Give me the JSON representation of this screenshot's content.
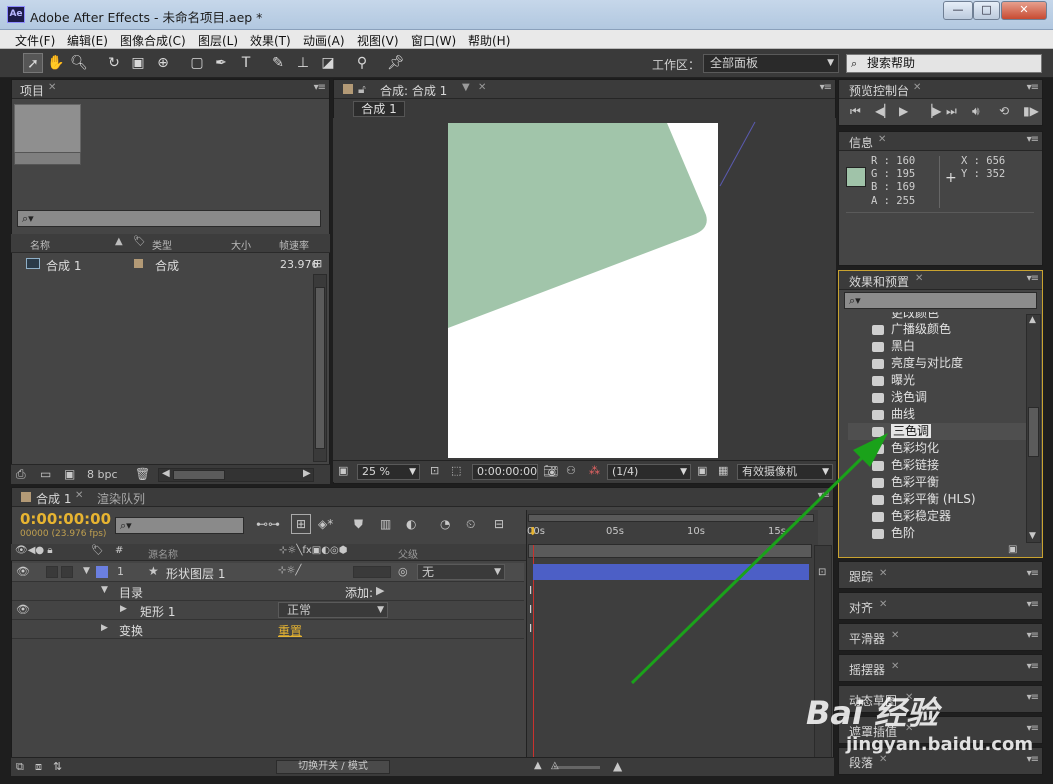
{
  "window": {
    "title": "Adobe After Effects - 未命名项目.aep *",
    "logo": "Ae",
    "buttons": [
      "—",
      "□",
      "✕"
    ]
  },
  "menu": [
    "文件(F)",
    "编辑(E)",
    "图像合成(C)",
    "图层(L)",
    "效果(T)",
    "动画(A)",
    "视图(V)",
    "窗口(W)",
    "帮助(H)"
  ],
  "toolbar": {
    "workspace_label": "工作区：",
    "workspace_value": "全部面板",
    "help_search": "搜索帮助"
  },
  "project": {
    "tab": "项目",
    "columns": [
      "名称",
      "类型",
      "大小",
      "帧速率"
    ],
    "rows": [
      {
        "name": "合成 1",
        "type": "合成",
        "fps": "23.976"
      }
    ],
    "bpc": "8 bpc"
  },
  "composition": {
    "tab": "合成: 合成 1",
    "subtab": "合成 1",
    "zoom": "25 %",
    "timecode": "0:00:00:00",
    "resolution": "(1/4)",
    "camera": "有效摄像机",
    "shape_color": "#a1c5aa"
  },
  "preview": {
    "tab": "预览控制台"
  },
  "info": {
    "tab": "信息",
    "r": "R : 160",
    "g": "G : 195",
    "b": "B : 169",
    "a": "A : 255",
    "x": "X : 656",
    "y": "Y : 352",
    "swatch": "#a0c3a9"
  },
  "effects": {
    "tab": "效果和预置",
    "items": [
      "更改颜色",
      "广播级颜色",
      "黑白",
      "亮度与对比度",
      "曝光",
      "浅色调",
      "曲线",
      "三色调",
      "色彩均化",
      "色彩链接",
      "色彩平衡",
      "色彩平衡 (HLS)",
      "色彩稳定器",
      "色阶"
    ],
    "highlighted": "三色调"
  },
  "side_panels": [
    "跟踪",
    "对齐",
    "平滑器",
    "摇摆器",
    "动态草图",
    "遮罩插值",
    "段落"
  ],
  "timeline": {
    "tab": "合成 1",
    "tab2": "渲染队列",
    "timecode": "0:00:00:00",
    "fps": "00000 (23.976 fps)",
    "col_source": "源名称",
    "col_parent": "父级",
    "layer_num": "1",
    "layer_name": "形状图层 1",
    "parent_value": "无",
    "contents": "目录",
    "add": "添加:",
    "rect": "矩形 1",
    "mode": "正常",
    "transform": "变换",
    "reset": "重置",
    "toggle_label": "切换开关 / 模式",
    "ruler": [
      "00s",
      "05s",
      "10s",
      "15s"
    ]
  },
  "watermark": {
    "text": "Bai 经验",
    "url": "jingyan.baidu.com"
  }
}
